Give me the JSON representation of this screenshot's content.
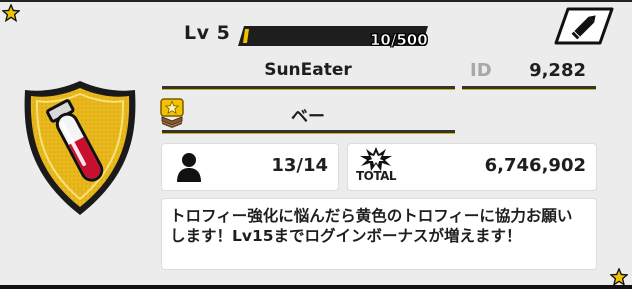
{
  "profile": {
    "level_label": "Lv 5",
    "xp_text": "10/500",
    "xp_fraction": 0.02,
    "edit_button_icon": "pencil-icon",
    "player_name": "SunEater",
    "id_label": "ID",
    "id_value": "9,282",
    "team_name": "ベー",
    "team_emblem_icon": "star-rank-emblem-icon",
    "members_icon": "person-icon",
    "members_value": "13/14",
    "total_label": "TOTAL",
    "total_value": "6,746,902",
    "comment": "トロフィー強化に悩んだら黄色のトロフィーに協力お願いします！Lv15までログインボーナスが増えます！",
    "badge_icon": "gold-shield-test-tube-badge-icon"
  },
  "colors": {
    "accent_gold": "#d4b400",
    "badge_gold": "#e8b81c",
    "tube_red": "#c8102e"
  }
}
